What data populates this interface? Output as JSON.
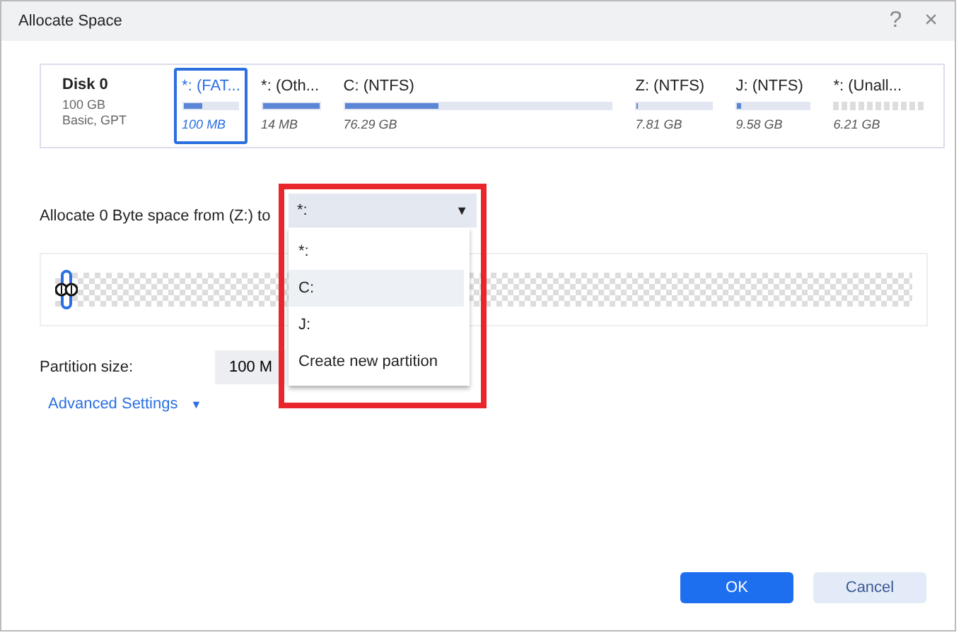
{
  "window": {
    "title": "Allocate Space",
    "help": "?",
    "close": "×"
  },
  "disk": {
    "name": "Disk 0",
    "size": "100 GB",
    "type": "Basic, GPT"
  },
  "partitions": [
    {
      "label": "*: (FAT...",
      "size": "100 MB",
      "kind": "used",
      "level": 0.35,
      "selected": true
    },
    {
      "label": "*: (Oth...",
      "size": "14 MB",
      "kind": "used",
      "level": 1,
      "selected": false
    },
    {
      "label": "C: (NTFS)",
      "size": "76.29 GB",
      "kind": "used",
      "level": 0.35,
      "selected": false
    },
    {
      "label": "Z: (NTFS)",
      "size": "7.81 GB",
      "kind": "used",
      "level": 0.02,
      "selected": false
    },
    {
      "label": "J: (NTFS)",
      "size": "9.58 GB",
      "kind": "used",
      "level": 0.05,
      "selected": false
    },
    {
      "label": "*: (Unall...",
      "size": "6.21 GB",
      "kind": "unallocated",
      "selected": false
    }
  ],
  "allocate": {
    "label": "Allocate 0 Byte space from (Z:) to",
    "value": "*:",
    "arrow": "▼",
    "options": [
      {
        "label": "*:",
        "highlighted": false
      },
      {
        "label": "C:",
        "highlighted": true
      },
      {
        "label": "J:",
        "highlighted": false
      },
      {
        "label": "Create new partition",
        "highlighted": false
      }
    ]
  },
  "partition_size": {
    "label": "Partition size:",
    "value": "100 M"
  },
  "advanced": {
    "label": "Advanced Settings",
    "arrow": "▼"
  },
  "buttons": [
    {
      "label": "OK",
      "kind": "primary"
    },
    {
      "label": "Cancel",
      "kind": "secondary"
    }
  ]
}
